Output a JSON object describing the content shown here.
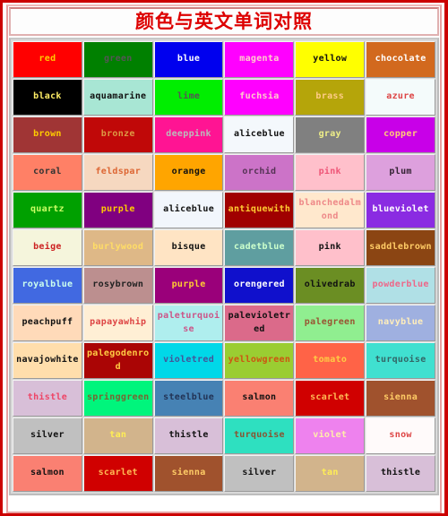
{
  "page": {
    "title": "颜色与英文单词对照",
    "border_color": "#cc0000",
    "title_color": "#dd0000"
  },
  "table": {
    "columns": 6,
    "rows": 12,
    "cells": [
      [
        {
          "label": "red",
          "bg": "#ff0000",
          "fg": "#ffcc00"
        },
        {
          "label": "green",
          "bg": "#008000",
          "fg": "#555555"
        },
        {
          "label": "blue",
          "bg": "#0000ee",
          "fg": "#ffffff"
        },
        {
          "label": "magenta",
          "bg": "#ff00ff",
          "fg": "#ffcccc"
        },
        {
          "label": "yellow",
          "bg": "#ffff00",
          "fg": "#111111"
        },
        {
          "label": "chocolate",
          "bg": "#d2691e",
          "fg": "#ffffff"
        }
      ],
      [
        {
          "label": "black",
          "bg": "#000000",
          "fg": "#ffee66"
        },
        {
          "label": "aquamarine",
          "bg": "#a8e6d4",
          "fg": "#111111"
        },
        {
          "label": "lime",
          "bg": "#00ee00",
          "fg": "#555555"
        },
        {
          "label": "fuchsia",
          "bg": "#ff00ff",
          "fg": "#ffcccc"
        },
        {
          "label": "brass",
          "bg": "#b5a50a",
          "fg": "#ffcc88"
        },
        {
          "label": "azure",
          "bg": "#f4fbfb",
          "fg": "#dd4444"
        }
      ],
      [
        {
          "label": "brown",
          "bg": "#a03535",
          "fg": "#ffcc00"
        },
        {
          "label": "bronze",
          "bg": "#c00808",
          "fg": "#dd9944"
        },
        {
          "label": "deeppink",
          "bg": "#ff1493",
          "fg": "#bbbbbb"
        },
        {
          "label": "aliceblue",
          "bg": "#f4f8fc",
          "fg": "#111111"
        },
        {
          "label": "gray",
          "bg": "#808080",
          "fg": "#eeee88"
        },
        {
          "label": "copper",
          "bg": "#c800e8",
          "fg": "#ffcc77"
        }
      ],
      [
        {
          "label": "coral",
          "bg": "#ff8066",
          "fg": "#333333"
        },
        {
          "label": "feldspar",
          "bg": "#f6d8c0",
          "fg": "#dd6633"
        },
        {
          "label": "orange",
          "bg": "#ffa500",
          "fg": "#111111"
        },
        {
          "label": "orchid",
          "bg": "#cc73c8",
          "fg": "#553355"
        },
        {
          "label": "pink",
          "bg": "#ffc0cb",
          "fg": "#ee5577"
        },
        {
          "label": "plum",
          "bg": "#dda0dd",
          "fg": "#332233"
        }
      ],
      [
        {
          "label": "quartz",
          "bg": "#00a000",
          "fg": "#ccff66"
        },
        {
          "label": "purple",
          "bg": "#800080",
          "fg": "#ffcc00"
        },
        {
          "label": "aliceblue",
          "bg": "#f2f6fc",
          "fg": "#111111"
        },
        {
          "label": "antiquewith",
          "bg": "#a00000",
          "fg": "#ffcc33"
        },
        {
          "label": "blanchedalmond",
          "bg": "#ffe8cd",
          "fg": "#ee8888"
        },
        {
          "label": "blueviolet",
          "bg": "#8a2be2",
          "fg": "#ffffff"
        }
      ],
      [
        {
          "label": "beige",
          "bg": "#f5f5dc",
          "fg": "#cc2222"
        },
        {
          "label": "burlywood",
          "bg": "#deb887",
          "fg": "#ffdd66"
        },
        {
          "label": "bisque",
          "bg": "#ffe4c4",
          "fg": "#111111"
        },
        {
          "label": "cadetblue",
          "bg": "#5f9ea0",
          "fg": "#ccffcc"
        },
        {
          "label": "pink",
          "bg": "#ffc0cb",
          "fg": "#111111"
        },
        {
          "label": "saddlebrown",
          "bg": "#8b4513",
          "fg": "#ffcc66"
        }
      ],
      [
        {
          "label": "royalblue",
          "bg": "#4169e1",
          "fg": "#ccffee"
        },
        {
          "label": "rosybrown",
          "bg": "#bc8f8f",
          "fg": "#222222"
        },
        {
          "label": "purple",
          "bg": "#9a007a",
          "fg": "#ffcc33"
        },
        {
          "label": "orengered",
          "bg": "#1010cc",
          "fg": "#ffffff"
        },
        {
          "label": "olivedrab",
          "bg": "#6b8e23",
          "fg": "#111111"
        },
        {
          "label": "powderblue",
          "bg": "#b0e0e6",
          "fg": "#ee6688"
        }
      ],
      [
        {
          "label": "peachpuff",
          "bg": "#ffdab9",
          "fg": "#111111"
        },
        {
          "label": "papayawhip",
          "bg": "#ffefd5",
          "fg": "#dd4444"
        },
        {
          "label": "paleturquoise",
          "bg": "#afeeee",
          "fg": "#cc5588"
        },
        {
          "label": "palevioletred",
          "bg": "#db6a8a",
          "fg": "#111111"
        },
        {
          "label": "palegreen",
          "bg": "#90ee90",
          "fg": "#995533"
        },
        {
          "label": "navyblue",
          "bg": "#9fb0e0",
          "fg": "#ffeebb"
        }
      ],
      [
        {
          "label": "navajowhite",
          "bg": "#ffdeac",
          "fg": "#111111"
        },
        {
          "label": "palegodenrod",
          "bg": "#aa0505",
          "fg": "#ffcc44"
        },
        {
          "label": "violetred",
          "bg": "#00d8e8",
          "fg": "#445599"
        },
        {
          "label": "yellowgreen",
          "bg": "#9acd32",
          "fg": "#cc5511"
        },
        {
          "label": "tomato",
          "bg": "#ff6347",
          "fg": "#ffcc44"
        },
        {
          "label": "turquoise",
          "bg": "#40e0d0",
          "fg": "#336666"
        }
      ],
      [
        {
          "label": "thistle",
          "bg": "#d8bfd8",
          "fg": "#ee4466"
        },
        {
          "label": "springgreen",
          "bg": "#00f57c",
          "fg": "#776633"
        },
        {
          "label": "steelblue",
          "bg": "#4682b4",
          "fg": "#223355"
        },
        {
          "label": "salmon",
          "bg": "#fa8072",
          "fg": "#111111"
        },
        {
          "label": "scarlet",
          "bg": "#d00000",
          "fg": "#ffbb55"
        },
        {
          "label": "sienna",
          "bg": "#a0522d",
          "fg": "#ffcc66"
        }
      ],
      [
        {
          "label": "silver",
          "bg": "#c0c0c0",
          "fg": "#111111"
        },
        {
          "label": "tan",
          "bg": "#d2b48c",
          "fg": "#ffee55"
        },
        {
          "label": "thistle",
          "bg": "#d8bfd8",
          "fg": "#111111"
        },
        {
          "label": "turquoise",
          "bg": "#2ee0c0",
          "fg": "#885533"
        },
        {
          "label": "violet",
          "bg": "#ee82ee",
          "fg": "#ffeeaa"
        },
        {
          "label": "snow",
          "bg": "#fffafa",
          "fg": "#dd4444"
        }
      ],
      [
        {
          "label": "salmon",
          "bg": "#fa8072",
          "fg": "#111111"
        },
        {
          "label": "scarlet",
          "bg": "#d00000",
          "fg": "#ffbb55"
        },
        {
          "label": "sienna",
          "bg": "#a0522d",
          "fg": "#ffcc66"
        },
        {
          "label": "silver",
          "bg": "#c0c0c0",
          "fg": "#111111"
        },
        {
          "label": "tan",
          "bg": "#d2b48c",
          "fg": "#ffee55"
        },
        {
          "label": "thistle",
          "bg": "#d8bfd8",
          "fg": "#111111"
        }
      ]
    ]
  }
}
